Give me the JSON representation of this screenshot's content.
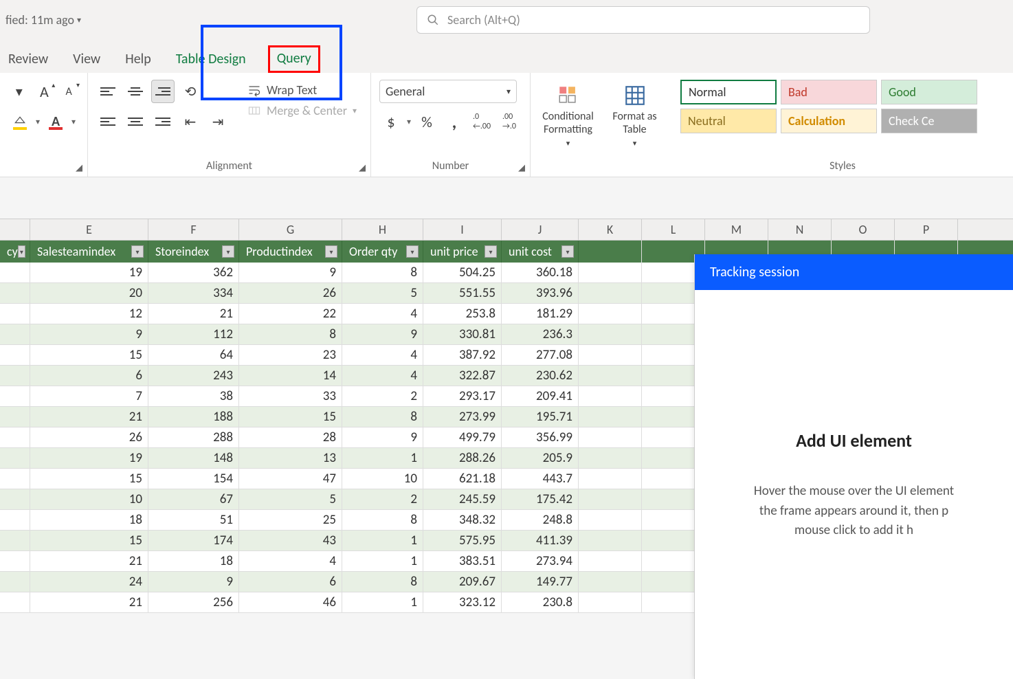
{
  "title": {
    "status": "fied: 11m ago"
  },
  "search": {
    "placeholder": "Search (Alt+Q)"
  },
  "tabs": {
    "review": "Review",
    "view": "View",
    "help": "Help",
    "table_design": "Table Design",
    "query": "Query"
  },
  "ribbon": {
    "wrap_text": "Wrap Text",
    "merge_center": "Merge & Center",
    "alignment_label": "Alignment",
    "number_format": "General",
    "number_label": "Number",
    "cond_fmt": "Conditional Formatting",
    "fmt_table": "Format as Table",
    "styles_label": "Styles",
    "style_normal": "Normal",
    "style_bad": "Bad",
    "style_good": "Good",
    "style_neutral": "Neutral",
    "style_calc": "Calculation",
    "style_check": "Check Ce"
  },
  "columns": {
    "stub": "cy",
    "E": "E",
    "F": "F",
    "G": "G",
    "H": "H",
    "I": "I",
    "J": "J",
    "K": "K",
    "L": "L",
    "M": "M",
    "N": "N",
    "O": "O",
    "P": "P"
  },
  "headers": {
    "E": "Salesteamindex",
    "F": "Storeindex",
    "G": "Productindex",
    "H": "Order qty",
    "I": "unit price",
    "J": "unit cost"
  },
  "rows": [
    {
      "E": "19",
      "F": "362",
      "G": "9",
      "H": "8",
      "I": "504.25",
      "J": "360.18"
    },
    {
      "E": "20",
      "F": "334",
      "G": "26",
      "H": "5",
      "I": "551.55",
      "J": "393.96"
    },
    {
      "E": "12",
      "F": "21",
      "G": "22",
      "H": "4",
      "I": "253.8",
      "J": "181.29"
    },
    {
      "E": "9",
      "F": "112",
      "G": "8",
      "H": "9",
      "I": "330.81",
      "J": "236.3"
    },
    {
      "E": "15",
      "F": "64",
      "G": "23",
      "H": "4",
      "I": "387.92",
      "J": "277.08"
    },
    {
      "E": "6",
      "F": "243",
      "G": "14",
      "H": "4",
      "I": "322.87",
      "J": "230.62"
    },
    {
      "E": "7",
      "F": "38",
      "G": "33",
      "H": "2",
      "I": "293.17",
      "J": "209.41"
    },
    {
      "E": "21",
      "F": "188",
      "G": "15",
      "H": "8",
      "I": "273.99",
      "J": "195.71"
    },
    {
      "E": "26",
      "F": "288",
      "G": "28",
      "H": "9",
      "I": "499.79",
      "J": "356.99"
    },
    {
      "E": "19",
      "F": "148",
      "G": "13",
      "H": "1",
      "I": "288.26",
      "J": "205.9"
    },
    {
      "E": "15",
      "F": "154",
      "G": "47",
      "H": "10",
      "I": "621.18",
      "J": "443.7"
    },
    {
      "E": "10",
      "F": "67",
      "G": "5",
      "H": "2",
      "I": "245.59",
      "J": "175.42"
    },
    {
      "E": "18",
      "F": "51",
      "G": "25",
      "H": "8",
      "I": "348.32",
      "J": "248.8"
    },
    {
      "E": "15",
      "F": "174",
      "G": "43",
      "H": "1",
      "I": "575.95",
      "J": "411.39"
    },
    {
      "E": "21",
      "F": "18",
      "G": "4",
      "H": "1",
      "I": "383.51",
      "J": "273.94"
    },
    {
      "E": "24",
      "F": "9",
      "G": "6",
      "H": "8",
      "I": "209.67",
      "J": "149.77"
    },
    {
      "E": "21",
      "F": "256",
      "G": "46",
      "H": "1",
      "I": "323.12",
      "J": "230.8"
    }
  ],
  "panel": {
    "title": "Tracking session",
    "heading": "Add UI element",
    "body1": "Hover the mouse over the UI element",
    "body2": "the frame appears around it, then p",
    "body3": "mouse click to add it h"
  }
}
